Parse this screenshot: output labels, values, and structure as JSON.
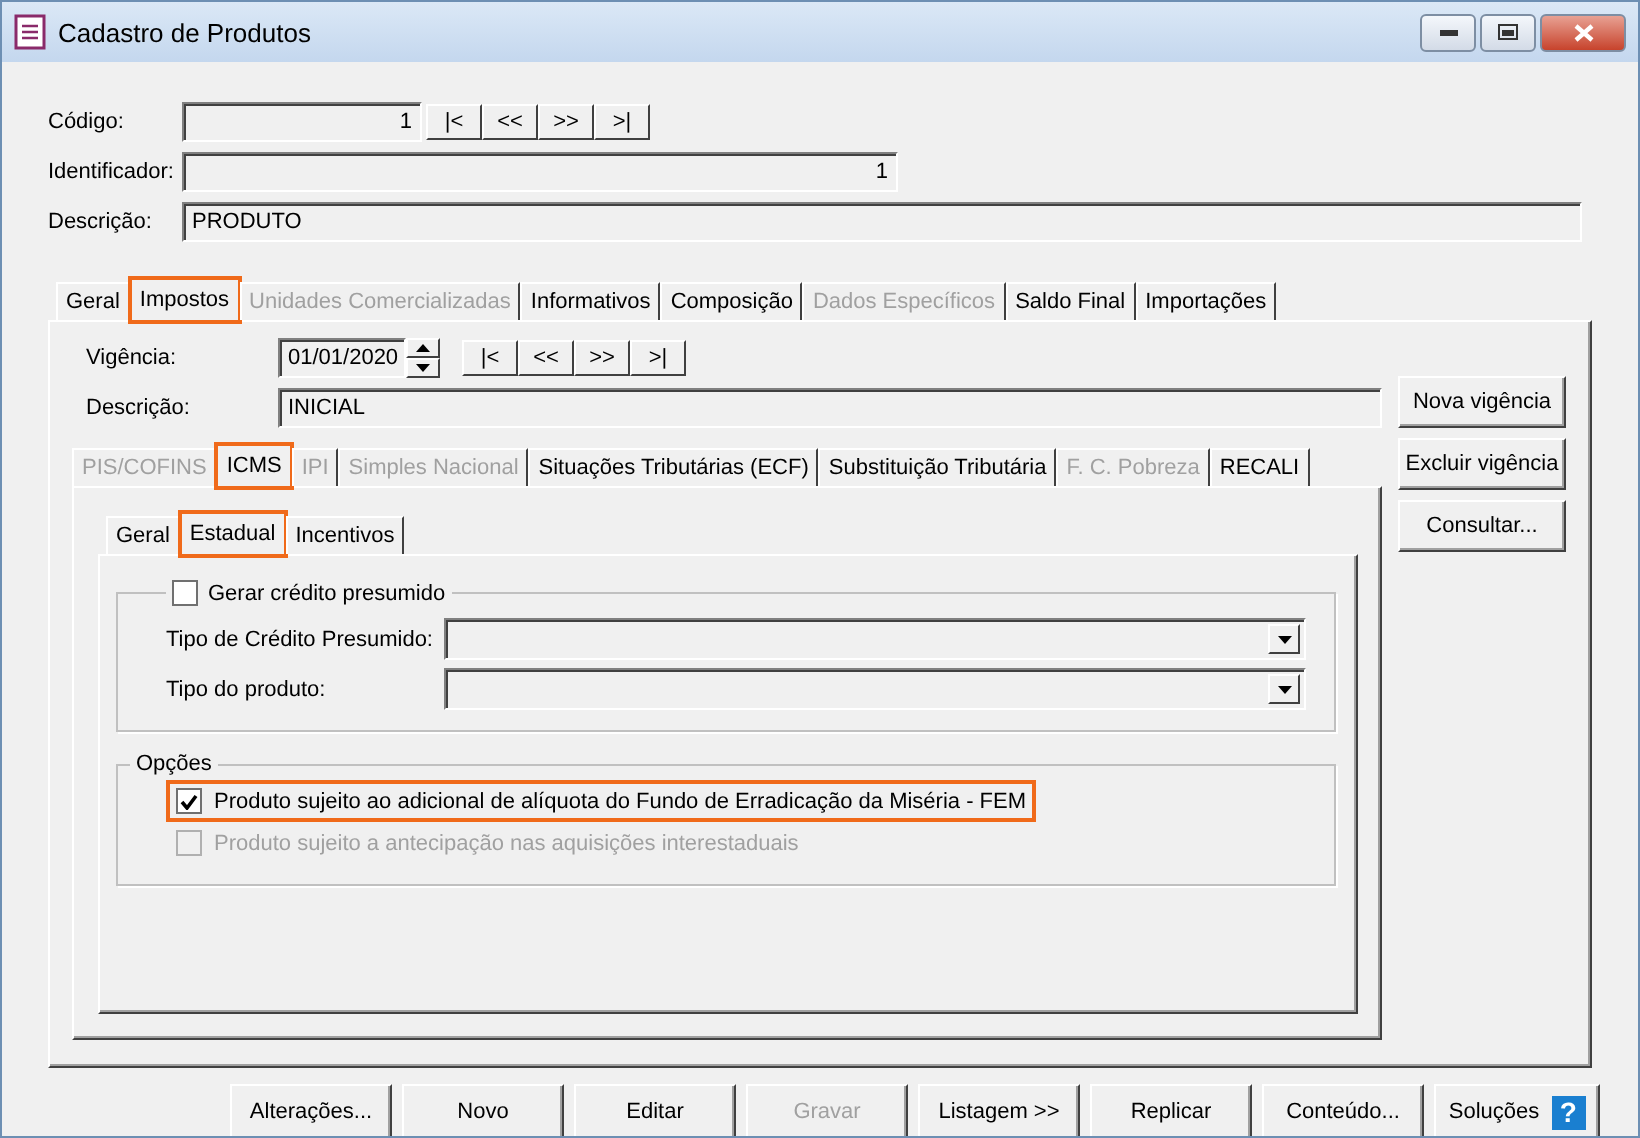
{
  "window": {
    "title": "Cadastro de Produtos"
  },
  "header_fields": [
    {
      "label": "Código:",
      "value": "1",
      "kind": "nav"
    },
    {
      "label": "Identificador:",
      "value": "1",
      "kind": "number"
    },
    {
      "label": "Descrição:",
      "value": "PRODUTO",
      "kind": "text"
    }
  ],
  "record_nav": [
    "|<",
    "<<",
    ">>",
    ">|"
  ],
  "main_tabs": [
    {
      "label": "Geral",
      "selected": false,
      "disabled": false,
      "highlighted": false
    },
    {
      "label": "Impostos",
      "selected": true,
      "disabled": false,
      "highlighted": true
    },
    {
      "label": "Unidades Comercializadas",
      "selected": false,
      "disabled": true,
      "highlighted": false
    },
    {
      "label": "Informativos",
      "selected": false,
      "disabled": false,
      "highlighted": false
    },
    {
      "label": "Composição",
      "selected": false,
      "disabled": false,
      "highlighted": false
    },
    {
      "label": "Dados Específicos",
      "selected": false,
      "disabled": true,
      "highlighted": false
    },
    {
      "label": "Saldo Final",
      "selected": false,
      "disabled": false,
      "highlighted": false
    },
    {
      "label": "Importações",
      "selected": false,
      "disabled": false,
      "highlighted": false
    }
  ],
  "vigencia": {
    "label": "Vigência:",
    "value": "01/01/2020",
    "nav": [
      "|<",
      "<<",
      ">>",
      ">|"
    ]
  },
  "descricao": {
    "label": "Descrição:",
    "value": "INICIAL"
  },
  "side_buttons": [
    "Nova vigência",
    "Excluir vigência",
    "Consultar..."
  ],
  "tax_tabs": [
    {
      "label": "PIS/COFINS",
      "selected": false,
      "disabled": true,
      "highlighted": false
    },
    {
      "label": "ICMS",
      "selected": true,
      "disabled": false,
      "highlighted": true
    },
    {
      "label": "IPI",
      "selected": false,
      "disabled": true,
      "highlighted": false
    },
    {
      "label": "Simples Nacional",
      "selected": false,
      "disabled": true,
      "highlighted": false
    },
    {
      "label": "Situações Tributárias (ECF)",
      "selected": false,
      "disabled": false,
      "highlighted": false
    },
    {
      "label": "Substituição Tributária",
      "selected": false,
      "disabled": false,
      "highlighted": false
    },
    {
      "label": "F. C. Pobreza",
      "selected": false,
      "disabled": true,
      "highlighted": false
    },
    {
      "label": "RECALI",
      "selected": false,
      "disabled": false,
      "highlighted": false
    }
  ],
  "icms_tabs": [
    {
      "label": "Geral",
      "selected": false,
      "disabled": false,
      "highlighted": false
    },
    {
      "label": "Estadual",
      "selected": true,
      "disabled": false,
      "highlighted": true
    },
    {
      "label": "Incentivos",
      "selected": false,
      "disabled": false,
      "highlighted": false
    }
  ],
  "credit_group": {
    "label": "Gerar crédito presumido",
    "checked": false,
    "fields": [
      {
        "label": "Tipo de Crédito Presumido:"
      },
      {
        "label": "Tipo do produto:"
      }
    ]
  },
  "options_group": {
    "title": "Opções",
    "options": [
      {
        "label": "Produto sujeito ao adicional de alíquota do Fundo de Erradicação da Miséria - FEM",
        "checked": true,
        "disabled": false,
        "highlighted": true
      },
      {
        "label": "Produto sujeito a antecipação nas aquisições interestaduais",
        "checked": false,
        "disabled": true,
        "highlighted": false
      }
    ]
  },
  "bottom_buttons": [
    {
      "label": "Alterações...",
      "disabled": false
    },
    {
      "label": "Novo",
      "disabled": false
    },
    {
      "label": "Editar",
      "disabled": false
    },
    {
      "label": "Gravar",
      "disabled": true
    },
    {
      "label": "Listagem >>",
      "disabled": false
    },
    {
      "label": "Replicar",
      "disabled": false
    },
    {
      "label": "Conteúdo...",
      "disabled": false
    }
  ],
  "help": {
    "label": "Soluções",
    "icon": "?"
  }
}
